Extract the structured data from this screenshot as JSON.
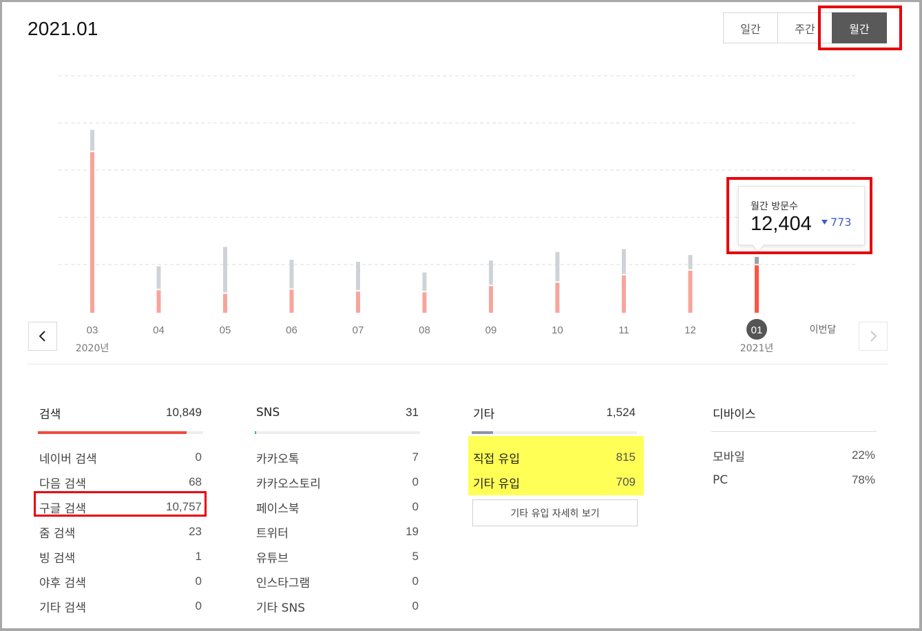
{
  "header": {
    "title": "2021.01"
  },
  "period_tabs": [
    {
      "label": "일간",
      "active": false
    },
    {
      "label": "주간",
      "active": false
    },
    {
      "label": "월간",
      "active": true
    }
  ],
  "chart_data": {
    "type": "bar",
    "categories": [
      "03",
      "04",
      "05",
      "06",
      "07",
      "08",
      "09",
      "10",
      "11",
      "12",
      "01"
    ],
    "year_labels": {
      "0": "2020년",
      "10": "2021년"
    },
    "current_label": "이번달",
    "stacked": true,
    "series": [
      {
        "values": [
          10850,
          1520,
          1280,
          1560,
          1430,
          1380,
          1800,
          2030,
          2520,
          2840,
          3200
        ],
        "color": "#f7a59c",
        "highlight_color": "#fb5545"
      },
      {
        "values": [
          1500,
          1620,
          3160,
          2020,
          2010,
          1340,
          1720,
          2070,
          1780,
          1060,
          573
        ],
        "color": "#cfd3d8",
        "highlight_color": "#9ea3a8"
      }
    ],
    "ylim": [
      0,
      16000
    ],
    "grid": true,
    "highlighted_index": 10
  },
  "tooltip": {
    "label": "월간 방문수",
    "value": "12,404",
    "delta": "773",
    "delta_dir": "down"
  },
  "nav": {
    "prev_icon": "chevron-left-icon",
    "next_icon": "chevron-right-icon"
  },
  "stats": {
    "search": {
      "label": "검색",
      "total": "10,849",
      "bar_fraction": 0.9,
      "bar_color": "#ef4b3f",
      "rows": [
        {
          "label": "네이버 검색",
          "value": "0"
        },
        {
          "label": "다음 검색",
          "value": "68"
        },
        {
          "label": "구글 검색",
          "value": "10,757"
        },
        {
          "label": "줌 검색",
          "value": "23"
        },
        {
          "label": "빙 검색",
          "value": "1"
        },
        {
          "label": "야후 검색",
          "value": "0"
        },
        {
          "label": "기타 검색",
          "value": "0"
        }
      ]
    },
    "sns": {
      "label": "SNS",
      "total": "31",
      "bar_fraction": 0.01,
      "bar_color": "#24c2a8",
      "rows": [
        {
          "label": "카카오톡",
          "value": "7"
        },
        {
          "label": "카카오스토리",
          "value": "0"
        },
        {
          "label": "페이스북",
          "value": "0"
        },
        {
          "label": "트위터",
          "value": "19"
        },
        {
          "label": "유튜브",
          "value": "5"
        },
        {
          "label": "인스타그램",
          "value": "0"
        },
        {
          "label": "기타 SNS",
          "value": "0"
        }
      ]
    },
    "etc": {
      "label": "기타",
      "total": "1,524",
      "bar_fraction": 0.13,
      "bar_color": "#8c93a8",
      "rows": [
        {
          "label": "직접 유입",
          "value": "815"
        },
        {
          "label": "기타 유입",
          "value": "709"
        }
      ],
      "detail_button": "기타 유입 자세히 보기"
    },
    "device": {
      "label": "디바이스",
      "rows": [
        {
          "label": "모바일",
          "value": "22%"
        },
        {
          "label": "PC",
          "value": "78%"
        }
      ]
    }
  },
  "colors": {
    "annotation_red": "#e8000b",
    "annotation_yellow": "#ffff55"
  }
}
